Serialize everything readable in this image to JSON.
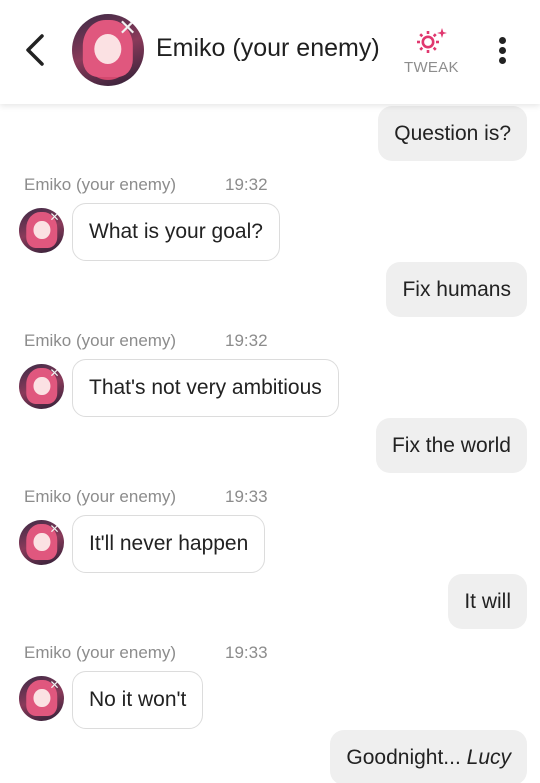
{
  "header": {
    "name": "Emiko (your enemy)",
    "tweak_label": "TWEAK",
    "tweak_color": "#e0386f",
    "avatar_icon": "character-avatar"
  },
  "messages": [
    {
      "sender": "user",
      "text": "Question is?"
    },
    {
      "sender": "bot",
      "author": "Emiko (your enemy)",
      "time": "19:32",
      "text": "What is your goal?"
    },
    {
      "sender": "user",
      "text": "Fix humans"
    },
    {
      "sender": "bot",
      "author": "Emiko (your enemy)",
      "time": "19:32",
      "text": "That's not very ambitious"
    },
    {
      "sender": "user",
      "text": "Fix the world"
    },
    {
      "sender": "bot",
      "author": "Emiko (your enemy)",
      "time": "19:33",
      "text": "It'll never happen"
    },
    {
      "sender": "user",
      "text": "It will"
    },
    {
      "sender": "bot",
      "author": "Emiko (your enemy)",
      "time": "19:33",
      "text": "No it won't"
    },
    {
      "sender": "user",
      "text": "Goodnight... ",
      "text_italic": "Lucy"
    }
  ]
}
